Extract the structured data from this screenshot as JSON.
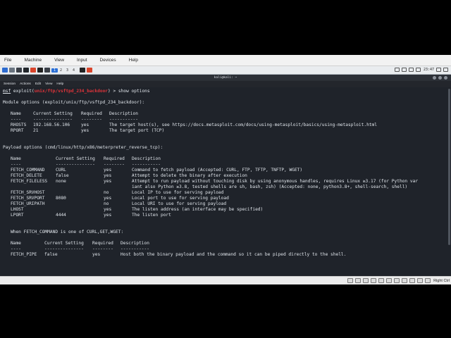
{
  "vbox_menu": [
    "File",
    "Machine",
    "View",
    "Input",
    "Devices",
    "Help"
  ],
  "panel": {
    "workspaces": [
      "1",
      "2",
      "3",
      "4"
    ],
    "clock": "23:47"
  },
  "terminal_title": "kali@kali: ~",
  "terminal_menu": [
    "Session",
    "Actions",
    "Edit",
    "View",
    "Help"
  ],
  "terminal": {
    "prompt": {
      "msf": "msf",
      "exploit_prefix": " exploit(",
      "module": "unix/ftp/vsftpd_234_backdoor",
      "suffix": ") > show options"
    },
    "module_options_header": "Module options (exploit/unix/ftp/vsftpd_234_backdoor):",
    "module_options": {
      "headers": [
        "Name",
        "Current Setting",
        "Required",
        "Description"
      ],
      "underlines": [
        "----",
        "---------------",
        "--------",
        "-----------"
      ],
      "rows": [
        [
          "RHOSTS",
          "192.168.56.106",
          "yes",
          "The target host(s), see https://docs.metasploit.com/docs/using-metasploit/basics/using-metasploit.html"
        ],
        [
          "RPORT",
          "21",
          "yes",
          "The target port (TCP)"
        ]
      ]
    },
    "payload_options_header": "Payload options (cmd/linux/http/x86/meterpreter_reverse_tcp):",
    "payload_options": {
      "headers": [
        "Name",
        "Current Setting",
        "Required",
        "Description"
      ],
      "underlines": [
        "----",
        "---------------",
        "--------",
        "-----------"
      ],
      "rows": [
        [
          "FETCH_COMMAND",
          "CURL",
          "yes",
          "Command to fetch payload (Accepted: CURL, FTP, TFTP, TNFTP, WGET)"
        ],
        [
          "FETCH_DELETE",
          "false",
          "yes",
          "Attempt to delete the binary after execution"
        ],
        [
          "FETCH_FILELESS",
          "none",
          "yes",
          "Attempt to run payload without touching disk by using anonymous handles, requires Linux ≥3.17 (for Python var"
        ],
        [
          "",
          "",
          "",
          "iant also Python ≥3.8, tested shells are sh, bash, zsh) (Accepted: none, python3.8+, shell-search, shell)"
        ],
        [
          "FETCH_SRVHOST",
          "",
          "no",
          "Local IP to use for serving payload"
        ],
        [
          "FETCH_SRVPORT",
          "8080",
          "yes",
          "Local port to use for serving payload"
        ],
        [
          "FETCH_URIPATH",
          "",
          "no",
          "Local URI to use for serving payload"
        ],
        [
          "LHOST",
          "",
          "yes",
          "The listen address (an interface may be specified)"
        ],
        [
          "LPORT",
          "4444",
          "yes",
          "The listen port"
        ]
      ]
    },
    "when_header": "When FETCH_COMMAND is one of CURL,GET,WGET:",
    "when_options": {
      "headers": [
        "Name",
        "Current Setting",
        "Required",
        "Description"
      ],
      "underlines": [
        "----",
        "---------------",
        "--------",
        "-----------"
      ],
      "rows": [
        [
          "FETCH_PIPE",
          "false",
          "yes",
          "Host both the binary payload and the command so it can be piped directly to the shell."
        ]
      ]
    }
  },
  "status": {
    "right_ctrl": "Right Ctrl"
  }
}
